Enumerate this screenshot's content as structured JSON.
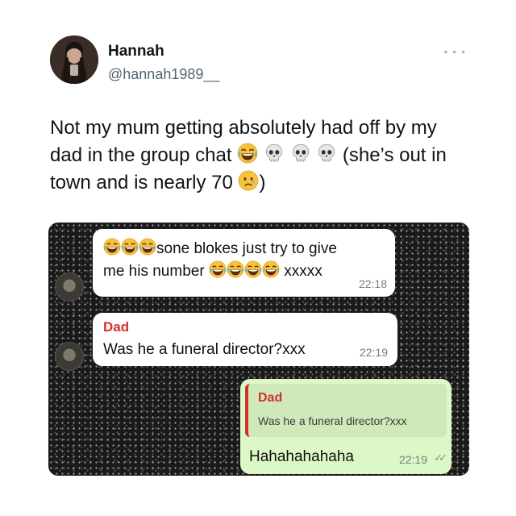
{
  "author": {
    "name": "Hannah",
    "handle": "@hannah1989__",
    "more_icon": "more-horizontal-icon"
  },
  "tweet": {
    "part1": "Not my mum getting absolutely had off by my dad in the group chat ",
    "part2": " (she’s out in town and is nearly 70 ",
    "part3": ")",
    "emojis": [
      "laughing-crying-emoji",
      "skull-emoji",
      "skull-emoji",
      "skull-emoji",
      "sad-tear-emoji"
    ]
  },
  "chat": {
    "message1": {
      "line1_text": "sone blokes just try to give",
      "line2_prefix": "me his number ",
      "line2_suffix": " xxxxx",
      "time": "22:18"
    },
    "message2": {
      "sender": "Dad",
      "text": "Was he a funeral director?xxx",
      "time": "22:19"
    },
    "message3": {
      "quote_sender": "Dad",
      "quote_text": "Was he a funeral director?xxx",
      "text": "Hahahahahaha",
      "time": "22:19",
      "ticks": "✓✓"
    },
    "colors": {
      "sender_name": "#d32f2f",
      "outgoing_bubble": "#dcf8c6",
      "incoming_bubble": "#ffffff"
    }
  }
}
